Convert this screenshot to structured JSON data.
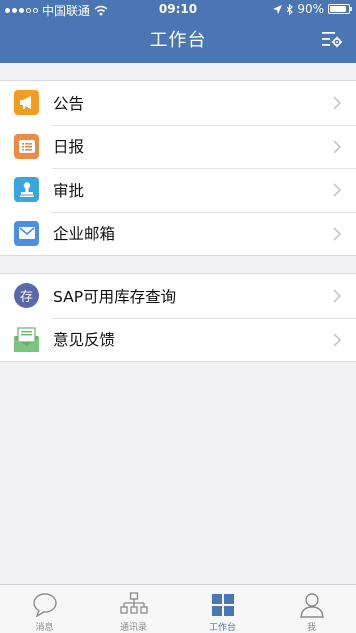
{
  "status_bar": {
    "carrier": "中国联通",
    "time": "09:10",
    "battery": "90%",
    "battery_level": 0.9
  },
  "header": {
    "title": "工作台",
    "action_icon": "filter-settings-icon"
  },
  "groups": [
    {
      "items": [
        {
          "label": "公告",
          "icon": "megaphone-icon",
          "color": "#f39c1f"
        },
        {
          "label": "日报",
          "icon": "list-icon",
          "color": "#ef8a44"
        },
        {
          "label": "审批",
          "icon": "stamp-icon",
          "color": "#3aa6e0"
        },
        {
          "label": "企业邮箱",
          "icon": "mail-icon",
          "color": "#4a8fe0"
        }
      ]
    },
    {
      "items": [
        {
          "label": "SAP可用库存查询",
          "icon": "inventory-icon",
          "icon_text": "存",
          "color": "#5a66ad"
        },
        {
          "label": "意见反馈",
          "icon": "feedback-icon",
          "color": "#68b56c"
        }
      ]
    }
  ],
  "tabbar": {
    "tabs": [
      {
        "label": "消息",
        "icon": "chat-bubble-icon",
        "active": false
      },
      {
        "label": "通讯录",
        "icon": "org-chart-icon",
        "active": false
      },
      {
        "label": "工作台",
        "icon": "grid-icon",
        "active": true
      },
      {
        "label": "我",
        "icon": "person-icon",
        "active": false
      }
    ]
  },
  "colors": {
    "accent": "#4a76b3",
    "background": "#f1f1f4",
    "inactive_tab": "#8c8c8c"
  }
}
